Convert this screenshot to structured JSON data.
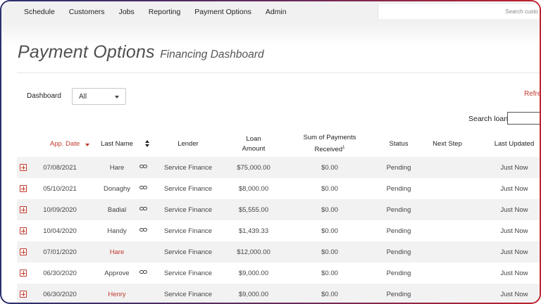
{
  "nav": {
    "items": [
      "Schedule",
      "Customers",
      "Jobs",
      "Reporting",
      "Payment Options",
      "Admin"
    ],
    "search_placeholder": "Search custo"
  },
  "header": {
    "title": "Payment Options",
    "subtitle": "Financing Dashboard"
  },
  "filters": {
    "dashboard_label": "Dashboard",
    "dashboard_value": "All",
    "refresh_label": "Refres"
  },
  "search": {
    "label": "Search loans:"
  },
  "table": {
    "columns": {
      "app_date": "App. Date",
      "last_name": "Last Name",
      "lender": "Lender",
      "loan_amount_l1": "Loan",
      "loan_amount_l2": "Amount",
      "payments_l1": "Sum of Payments",
      "payments_l2": "Received",
      "payments_sup": "1",
      "status": "Status",
      "next_step": "Next Step",
      "last_updated": "Last Updated"
    },
    "rows": [
      {
        "date": "07/08/2021",
        "name": "Hare",
        "lender": "Service Finance",
        "amount": "$75,000.00",
        "payments": "$0.00",
        "status": "Pending",
        "next_step": "",
        "updated": "Just Now"
      },
      {
        "date": "05/10/2021",
        "name": "Donaghy",
        "lender": "Service Finance",
        "amount": "$8,000.00",
        "payments": "$0.00",
        "status": "Pending",
        "next_step": "",
        "updated": "Just Now"
      },
      {
        "date": "10/09/2020",
        "name": "Badial",
        "lender": "Service Finance",
        "amount": "$5,555.00",
        "payments": "$0.00",
        "status": "Pending",
        "next_step": "",
        "updated": "Just Now"
      },
      {
        "date": "10/04/2020",
        "name": "Handy",
        "lender": "Service Finance",
        "amount": "$1,439.33",
        "payments": "$0.00",
        "status": "Pending",
        "next_step": "",
        "updated": "Just Now"
      },
      {
        "date": "07/01/2020",
        "name": "Hare",
        "lender": "Service Finance",
        "amount": "$12,000.00",
        "payments": "$0.00",
        "status": "Pending",
        "next_step": "",
        "updated": "Just Now"
      },
      {
        "date": "06/30/2020",
        "name": "Approve",
        "lender": "Service Finance",
        "amount": "$9,000.00",
        "payments": "$0.00",
        "status": "Pending",
        "next_step": "",
        "updated": "Just Now"
      },
      {
        "date": "06/30/2020",
        "name": "Henry",
        "lender": "Service Finance",
        "amount": "$9,000.00",
        "payments": "$0.00",
        "status": "Pending",
        "next_step": "",
        "updated": "Just Now"
      }
    ]
  }
}
